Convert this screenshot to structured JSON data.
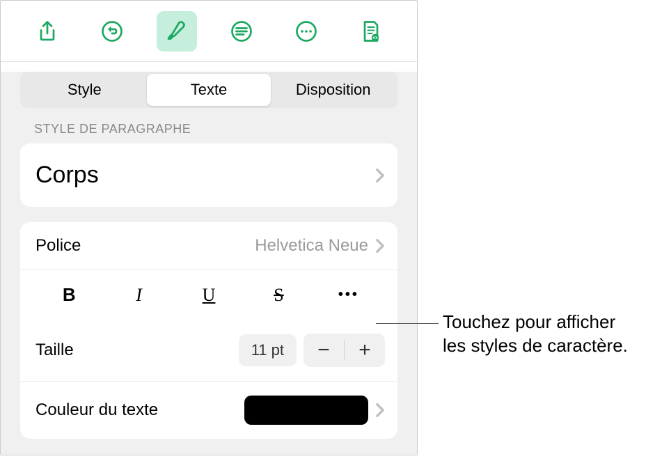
{
  "tabs": {
    "style": "Style",
    "texte": "Texte",
    "disposition": "Disposition"
  },
  "paragraphStyle": {
    "header": "Style de paragraphe",
    "value": "Corps"
  },
  "font": {
    "label": "Police",
    "value": "Helvetica Neue"
  },
  "formats": {
    "bold": "B",
    "italic": "I",
    "underline": "U",
    "strike": "S",
    "more": "•••"
  },
  "size": {
    "label": "Taille",
    "value": "11 pt",
    "minus": "−",
    "plus": "+"
  },
  "textColor": {
    "label": "Couleur du texte"
  },
  "callout": {
    "line1": "Touchez pour afficher",
    "line2": "les styles de caractère."
  },
  "colors": {
    "accent": "#1da861"
  }
}
